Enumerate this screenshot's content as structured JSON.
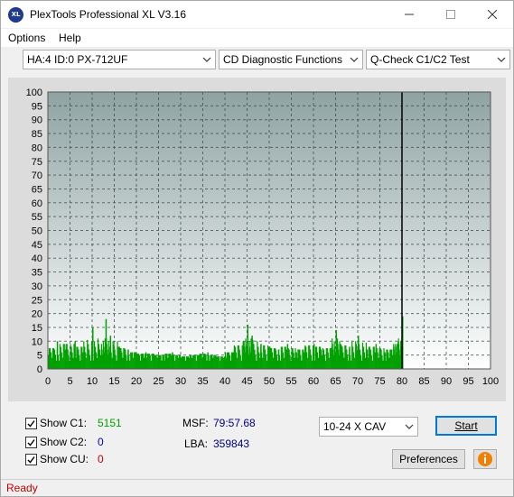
{
  "window": {
    "title": "PlexTools Professional XL V3.16",
    "icon_text": "XL",
    "controls": [
      "minimize-icon",
      "maximize-icon",
      "close-icon"
    ]
  },
  "menu": {
    "options": "Options",
    "help": "Help"
  },
  "toolbar": {
    "drive": "HA:4 ID:0  PX-712UF",
    "function": "CD Diagnostic Functions",
    "test": "Q-Check C1/C2 Test"
  },
  "chart_data": {
    "type": "bar",
    "title": "",
    "xlabel": "",
    "ylabel": "",
    "xlim": [
      0,
      100
    ],
    "ylim": [
      0,
      100
    ],
    "x_ticks": [
      "0",
      "5",
      "10",
      "15",
      "20",
      "25",
      "30",
      "35",
      "40",
      "45",
      "50",
      "55",
      "60",
      "65",
      "70",
      "75",
      "80",
      "85",
      "90",
      "95",
      "100"
    ],
    "y_ticks": [
      "0",
      "5",
      "10",
      "15",
      "20",
      "25",
      "30",
      "35",
      "40",
      "45",
      "50",
      "55",
      "60",
      "65",
      "70",
      "75",
      "80",
      "85",
      "90",
      "95",
      "100"
    ],
    "grid": true,
    "end_marker_x": 80,
    "series": [
      {
        "color": "#00a000",
        "x": [
          0,
          2,
          4,
          6,
          8,
          10,
          12,
          13,
          14,
          16,
          18,
          20,
          22,
          24,
          26,
          28,
          30,
          32,
          34,
          36,
          38,
          40,
          42,
          44,
          45,
          46,
          48,
          50,
          52,
          54,
          56,
          58,
          60,
          62,
          64,
          65,
          66,
          68,
          70,
          72,
          74,
          76,
          78,
          79,
          80
        ],
        "values": [
          5,
          10,
          8,
          10,
          6,
          15,
          7,
          18,
          12,
          8,
          7,
          5,
          6,
          5,
          5,
          6,
          4,
          5,
          5,
          6,
          4,
          5,
          7,
          10,
          16,
          12,
          9,
          8,
          7,
          9,
          6,
          8,
          9,
          7,
          8,
          14,
          9,
          8,
          12,
          7,
          9,
          6,
          8,
          10,
          19
        ]
      }
    ]
  },
  "bottom": {
    "show_c1_label": "Show C1:",
    "show_c1_value": "5151",
    "show_c2_label": "Show C2:",
    "show_c2_value": "0",
    "show_cu_label": "Show CU:",
    "show_cu_value": "0",
    "msf_label": "MSF:",
    "msf_value": "79:57.68",
    "lba_label": "LBA:",
    "lba_value": "359843",
    "speed": "10-24 X CAV",
    "start": "Start",
    "preferences": "Preferences",
    "c1_color": "#00a000",
    "c2_color": "#0000c0",
    "cu_color": "#c00000",
    "value_color": "#000080"
  },
  "status": "Ready"
}
